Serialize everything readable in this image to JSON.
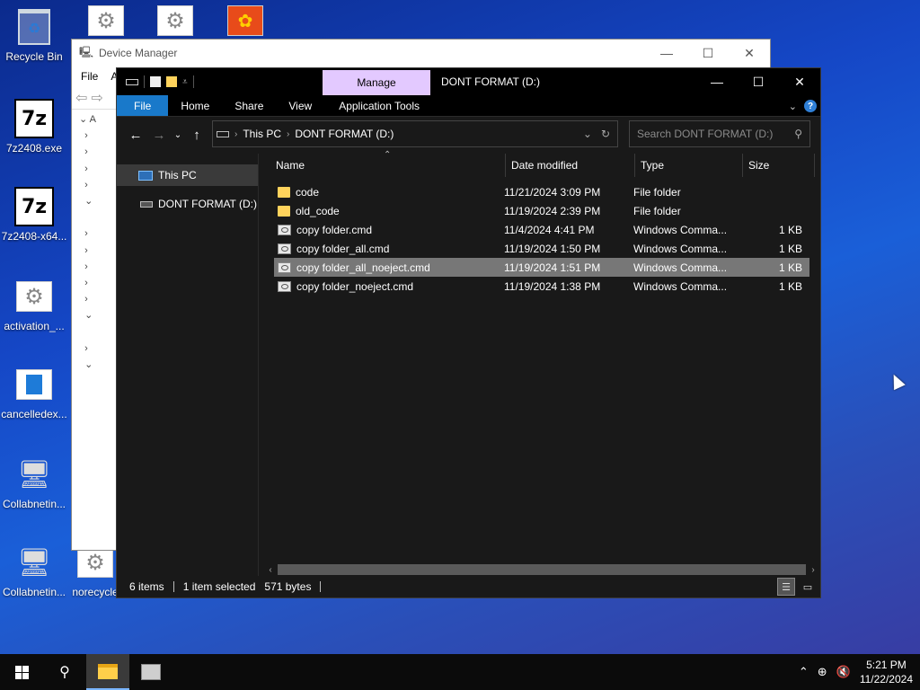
{
  "desktop": {
    "icons": [
      {
        "label": "Recycle Bin",
        "icon": "recycle-bin-icon"
      },
      {
        "label": "7z2408.exe",
        "icon": "7zip-icon"
      },
      {
        "label": "7z2408-x64...",
        "icon": "7zip-icon"
      },
      {
        "label": "activation_...",
        "icon": "settings-file-icon"
      },
      {
        "label": "cancelledex...",
        "icon": "document-icon"
      },
      {
        "label": "Collabnetin...",
        "icon": "network-computer-icon"
      },
      {
        "label": "Collabnetin...",
        "icon": "network-computer-icon"
      },
      {
        "label": "norecycle",
        "icon": "settings-file-icon"
      }
    ]
  },
  "device_manager": {
    "title": "Device Manager",
    "menu": [
      "File",
      "A"
    ],
    "tree_first": "A"
  },
  "explorer": {
    "caption": "DONT FORMAT (D:)",
    "manage_tab": "Manage",
    "ribbon_tabs": [
      "File",
      "Home",
      "Share",
      "View",
      "Application Tools"
    ],
    "address": {
      "root": "This PC",
      "current": "DONT FORMAT (D:)"
    },
    "search": {
      "placeholder": "Search DONT FORMAT (D:)",
      "value": ""
    },
    "nav_pane": [
      {
        "label": "This PC",
        "icon": "computer-icon",
        "selected": true
      },
      {
        "label": "DONT FORMAT (D:)",
        "icon": "drive-icon",
        "selected": false
      }
    ],
    "columns": [
      "Name",
      "Date modified",
      "Type",
      "Size"
    ],
    "files": [
      {
        "name": "code",
        "date": "11/21/2024 3:09 PM",
        "type": "File folder",
        "size": "",
        "icon": "folder-icon",
        "selected": false
      },
      {
        "name": "old_code",
        "date": "11/19/2024 2:39 PM",
        "type": "File folder",
        "size": "",
        "icon": "folder-icon",
        "selected": false
      },
      {
        "name": "copy folder.cmd",
        "date": "11/4/2024 4:41 PM",
        "type": "Windows Comma...",
        "size": "1 KB",
        "icon": "cmd-file-icon",
        "selected": false
      },
      {
        "name": "copy folder_all.cmd",
        "date": "11/19/2024 1:50 PM",
        "type": "Windows Comma...",
        "size": "1 KB",
        "icon": "cmd-file-icon",
        "selected": false
      },
      {
        "name": "copy folder_all_noeject.cmd",
        "date": "11/19/2024 1:51 PM",
        "type": "Windows Comma...",
        "size": "1 KB",
        "icon": "cmd-file-icon",
        "selected": true
      },
      {
        "name": "copy folder_noeject.cmd",
        "date": "11/19/2024 1:38 PM",
        "type": "Windows Comma...",
        "size": "1 KB",
        "icon": "cmd-file-icon",
        "selected": false
      }
    ],
    "status": {
      "items": "6 items",
      "selected": "1 item selected",
      "size": "571 bytes"
    }
  },
  "taskbar": {
    "time": "5:21 PM",
    "date": "11/22/2024"
  },
  "colors": {
    "accent": "#1979ca",
    "manage_tab": "#e3c9ff",
    "selection": "#777777",
    "folder": "#ffd35c"
  }
}
